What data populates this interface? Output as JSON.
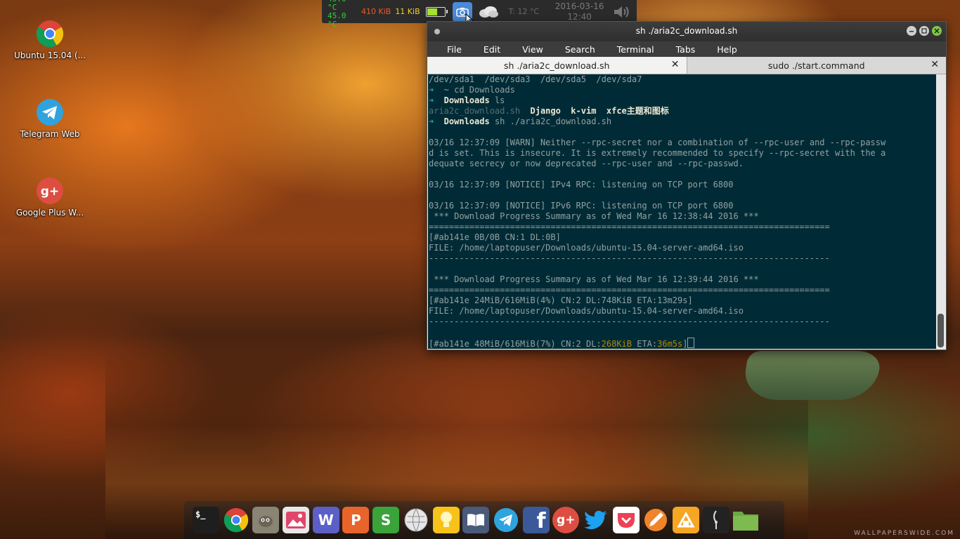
{
  "top_panel": {
    "cpu_temp": "45.0 °C",
    "gpu_temp": "45.0 °C",
    "net_down": "410 KiB",
    "net_up": "11 KiB",
    "battery_level": 0.55,
    "weather_temp": "T: 12 °C",
    "date": "2016-03-16",
    "time": "12:40"
  },
  "desktop": {
    "icons": [
      {
        "label": "Ubuntu 15.04 (..."
      },
      {
        "label": "Telegram Web"
      },
      {
        "label": "Google Plus W..."
      }
    ]
  },
  "terminal": {
    "title": "sh ./aria2c_download.sh",
    "menu": [
      "File",
      "Edit",
      "View",
      "Search",
      "Terminal",
      "Tabs",
      "Help"
    ],
    "tabs": [
      {
        "label": "sh ./aria2c_download.sh",
        "close": "✕"
      },
      {
        "label": "sudo ./start.command",
        "close": "✕"
      }
    ],
    "lines": {
      "l1": "/dev/sda1  /dev/sda3  /dev/sda5  /dev/sda7",
      "l2_arrow": "➜",
      "l2_cmd": "  ~ cd Downloads",
      "l3_arrow": "➜",
      "l3_dir": "  Downloads",
      "l3_cmd": " ls",
      "l4_file": "aria2c_download.sh",
      "l4_dirs": "  Django  k-vim  xfce主题和图标",
      "l5_arrow": "➜",
      "l5_dir": "  Downloads",
      "l5_cmd": " sh ./aria2c_download.sh",
      "l7": "03/16 12:37:09 [WARN] Neither --rpc-secret nor a combination of --rpc-user and --rpc-passw",
      "l8": "d is set. This is insecure. It is extremely recommended to specify --rpc-secret with the a",
      "l9": "dequate secrecy or now deprecated --rpc-user and --rpc-passwd.",
      "l11": "03/16 12:37:09 [NOTICE] IPv4 RPC: listening on TCP port 6800",
      "l13": "03/16 12:37:09 [NOTICE] IPv6 RPC: listening on TCP port 6800",
      "l14": " *** Download Progress Summary as of Wed Mar 16 12:38:44 2016 ***",
      "l15": "===============================================================================",
      "l16": "[#ab141e 0B/0B CN:1 DL:0B]",
      "l17": "FILE: /home/laptopuser/Downloads/ubuntu-15.04-server-amd64.iso",
      "l18": "-------------------------------------------------------------------------------",
      "l20": " *** Download Progress Summary as of Wed Mar 16 12:39:44 2016 ***",
      "l21": "===============================================================================",
      "l22": "[#ab141e 24MiB/616MiB(4%) CN:2 DL:748KiB ETA:13m29s]",
      "l23": "FILE: /home/laptopuser/Downloads/ubuntu-15.04-server-amd64.iso",
      "l24": "-------------------------------------------------------------------------------",
      "l26_a": "[#ab141e 48MiB/616MiB(7%) CN:2 DL:",
      "l26_dl": "268KiB",
      "l26_b": " ETA:",
      "l26_eta": "36m5s",
      "l26_c": "]"
    }
  },
  "dock": {
    "terminal_glyph": "$_",
    "wps_writer": "W",
    "wps_presentation": "P",
    "wps_spreadsheet": "S",
    "google_plus": "g+",
    "facebook": "f"
  },
  "watermark": "WALLPAPERSWIDE.COM",
  "colors": {
    "terminal_bg": "#002b36",
    "terminal_fg": "#93a1a1",
    "prompt_arrow": "#2aa198",
    "highlight_yellow": "#b58900",
    "accent_blue": "#4a8ad8"
  }
}
